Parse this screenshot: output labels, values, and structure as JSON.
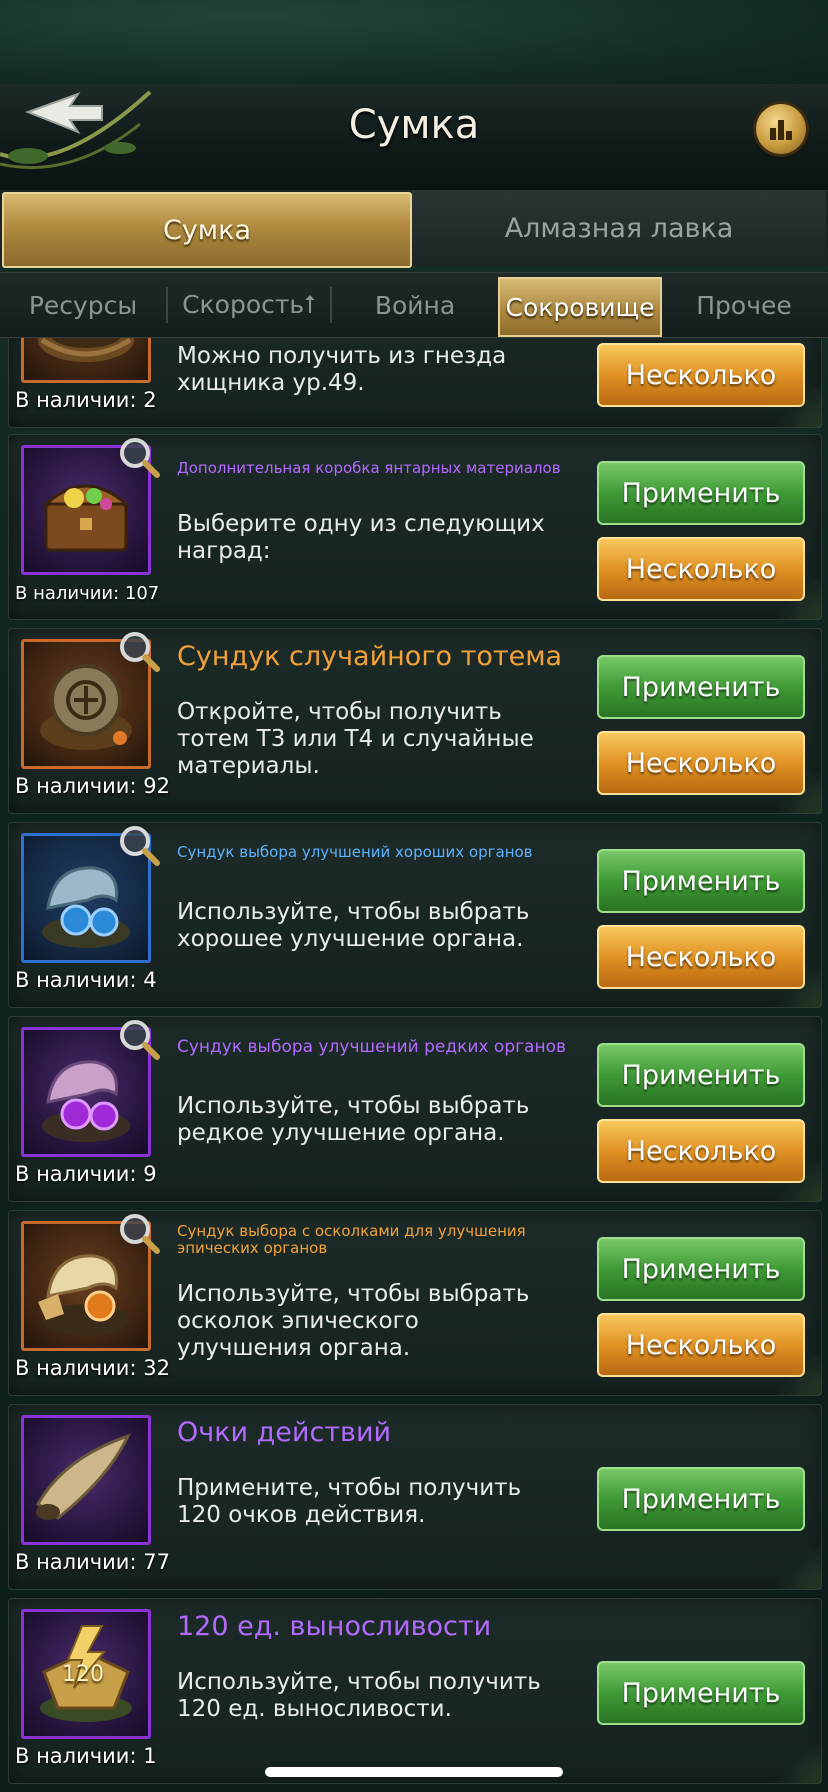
{
  "header": {
    "title": "Сумка"
  },
  "main_tabs": [
    {
      "label": "Сумка",
      "active": true
    },
    {
      "label": "Алмазная лавка",
      "active": false
    }
  ],
  "sub_tabs": [
    {
      "label": "Ресурсы"
    },
    {
      "label": "Скорость⭡"
    },
    {
      "label": "Война"
    },
    {
      "label": "Сокровище",
      "active": true
    },
    {
      "label": "Прочее"
    }
  ],
  "items": [
    {
      "title": "",
      "desc": "Можно получить из гнезда хищника ур.49.",
      "count": "В наличии: 2",
      "apply": "",
      "multiple": "Несколько"
    },
    {
      "title": "Дополнительная коробка янтарных материалов",
      "desc": "Выберите одну из следующих наград:",
      "count": "В наличии: 107",
      "apply": "Применить",
      "multiple": "Несколько",
      "title_color": "#b26aff"
    },
    {
      "title": "Сундук случайного тотема",
      "desc": "Откройте, чтобы получить тотем T3 или T4 и случайные материалы.",
      "count": "В наличии: 92",
      "apply": "Применить",
      "multiple": "Несколько",
      "title_color": "#f3a23a"
    },
    {
      "title": "Сундук выбора улучшений хороших органов",
      "desc": "Используйте, чтобы выбрать хорошее улучшение органа.",
      "count": "В наличии: 4",
      "apply": "Применить",
      "multiple": "Несколько",
      "title_color": "#5eb2ff"
    },
    {
      "title": "Сундук выбора улучшений редких органов",
      "desc": "Используйте, чтобы выбрать редкое улучшение органа.",
      "count": "В наличии: 9",
      "apply": "Применить",
      "multiple": "Несколько",
      "title_color": "#b26aff"
    },
    {
      "title": "Сундук выбора с осколками для улучшения эпических органов",
      "desc": "Используйте, чтобы выбрать осколок эпического улучшения органа.",
      "count": "В наличии: 32",
      "apply": "Применить",
      "multiple": "Несколько",
      "title_color": "#f3a23a"
    },
    {
      "title": "Очки действий",
      "desc": "Примените, чтобы получить 120 очков действия.",
      "count": "В наличии: 77",
      "apply": "Применить",
      "title_color": "#b26aff"
    },
    {
      "title": "120 ед. выносливости",
      "desc": "Используйте, чтобы получить 120 ед. выносливости.",
      "count": "В наличии: 1",
      "apply": "Применить",
      "title_color": "#b26aff",
      "icon_label": "120"
    }
  ],
  "icons": {
    "back": "back-arrow-icon",
    "stats": "bar-chart-icon",
    "inspect": "magnifier-icon"
  }
}
